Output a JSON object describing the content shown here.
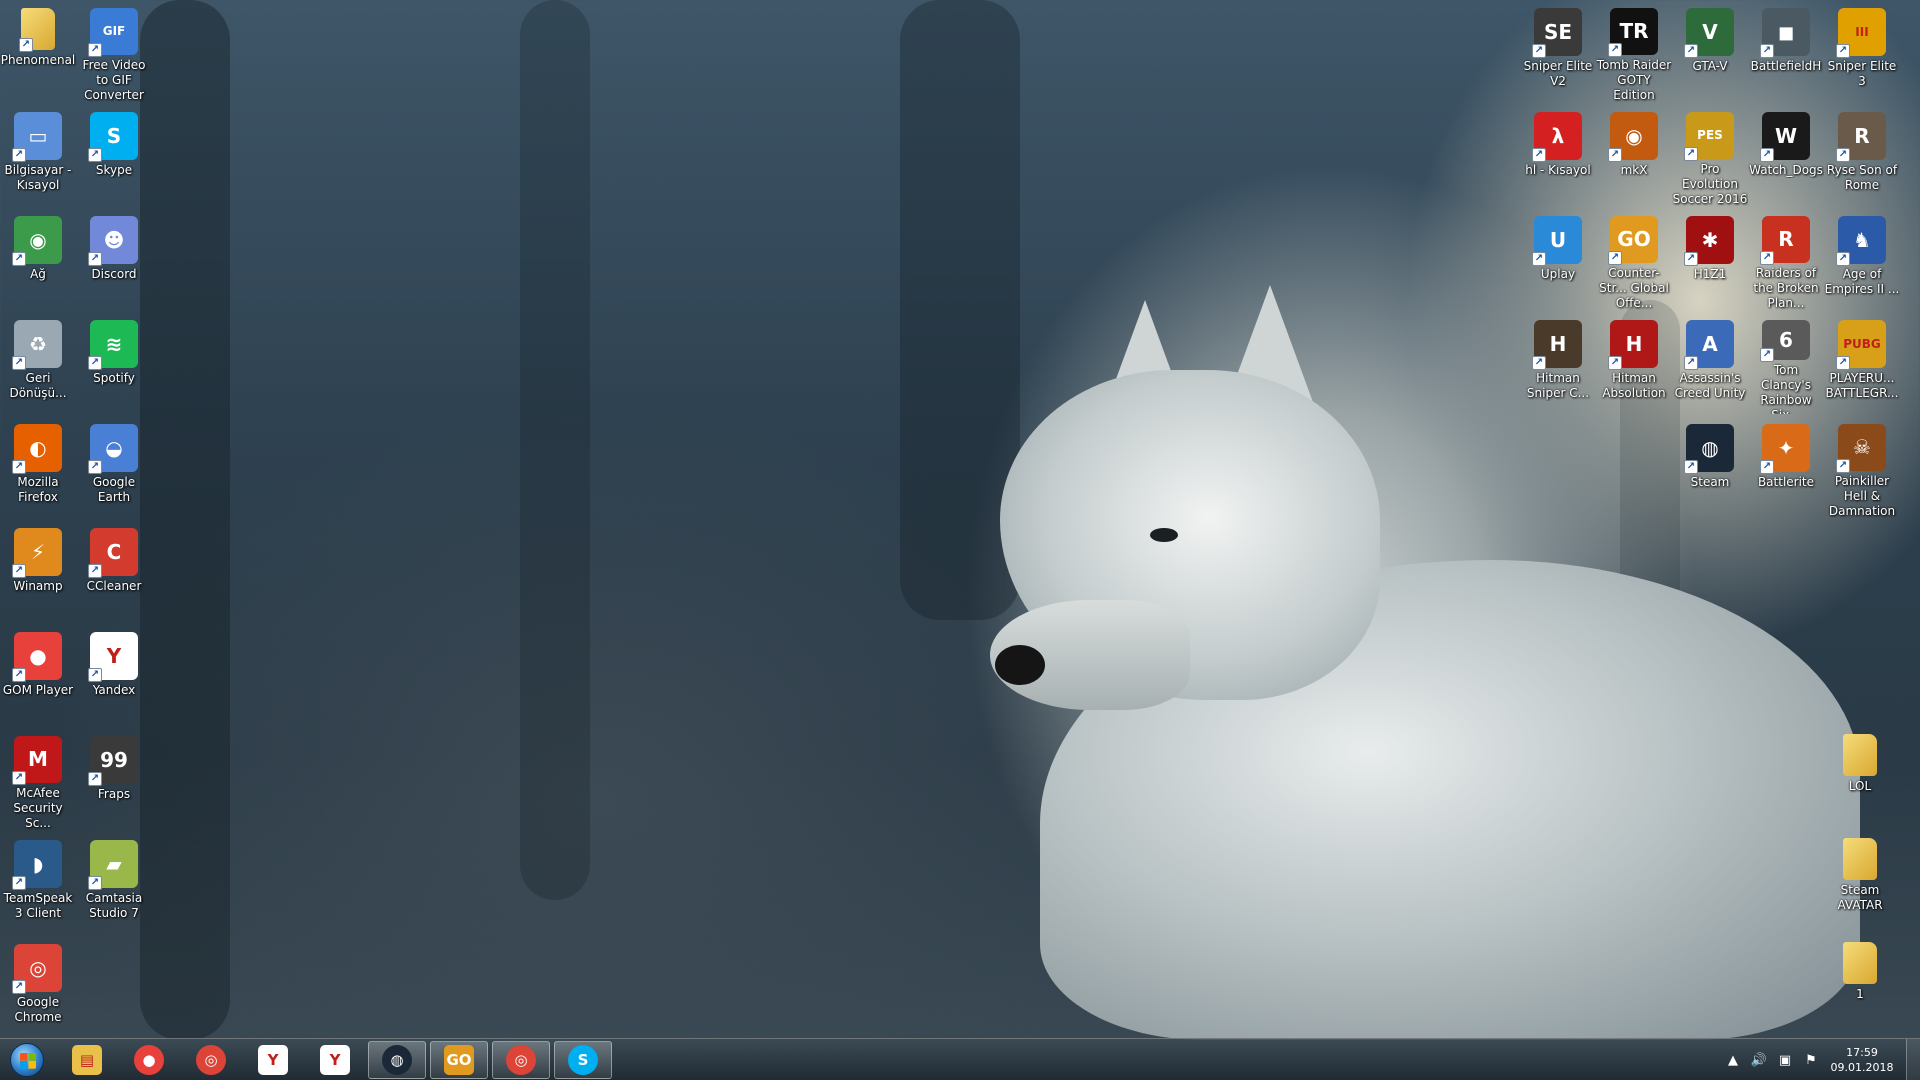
{
  "desktop": {
    "left_icons": [
      {
        "label": "Phenomenal",
        "icon": "folder-icon",
        "color": "#e8c04a",
        "glyph": ""
      },
      {
        "label": "Free Video to GIF Converter",
        "icon": "gif-converter-icon",
        "color": "#3a7bd5",
        "glyph": "GIF"
      },
      {
        "label": "Bilgisayar - Kısayol",
        "icon": "computer-icon",
        "color": "#5a8ed8",
        "glyph": "▭"
      },
      {
        "label": "Skype",
        "icon": "skype-icon",
        "color": "#00aff0",
        "glyph": "S"
      },
      {
        "label": "Ağ",
        "icon": "network-icon",
        "color": "#3b9b4a",
        "glyph": "◉"
      },
      {
        "label": "Discord",
        "icon": "discord-icon",
        "color": "#7289da",
        "glyph": "☻"
      },
      {
        "label": "Geri Dönüşü...",
        "icon": "recycle-bin-icon",
        "color": "#9aa8b4",
        "glyph": "♻"
      },
      {
        "label": "Spotify",
        "icon": "spotify-icon",
        "color": "#1db954",
        "glyph": "≋"
      },
      {
        "label": "Mozilla Firefox",
        "icon": "firefox-icon",
        "color": "#e66000",
        "glyph": "◐"
      },
      {
        "label": "Google Earth",
        "icon": "google-earth-icon",
        "color": "#4a7fd6",
        "glyph": "◒"
      },
      {
        "label": "Winamp",
        "icon": "winamp-icon",
        "color": "#e08a1e",
        "glyph": "⚡"
      },
      {
        "label": "CCleaner",
        "icon": "ccleaner-icon",
        "color": "#d33b2f",
        "glyph": "C"
      },
      {
        "label": "GOM Player",
        "icon": "gom-player-icon",
        "color": "#e8403a",
        "glyph": "●"
      },
      {
        "label": "Yandex",
        "icon": "yandex-icon",
        "color": "#ffffff",
        "glyph": "Y"
      },
      {
        "label": "McAfee Security Sc...",
        "icon": "mcafee-icon",
        "color": "#c01818",
        "glyph": "M"
      },
      {
        "label": "Fraps",
        "icon": "fraps-icon",
        "color": "#3a3a3a",
        "glyph": "99"
      },
      {
        "label": "TeamSpeak 3 Client",
        "icon": "teamspeak-icon",
        "color": "#2a5a8a",
        "glyph": "◗"
      },
      {
        "label": "Camtasia Studio 7",
        "icon": "camtasia-icon",
        "color": "#9ab84a",
        "glyph": "▰"
      },
      {
        "label": "Google Chrome",
        "icon": "chrome-icon",
        "color": "#db4437",
        "glyph": "◎"
      }
    ],
    "right_icons": [
      {
        "label": "Sniper Elite V2",
        "icon": "sniper-elite-v2-icon",
        "color": "#3a3a3a",
        "glyph": "SE"
      },
      {
        "label": "Tomb Raider GOTY Edition",
        "icon": "tomb-raider-icon",
        "color": "#111111",
        "glyph": "TR"
      },
      {
        "label": "GTA-V",
        "icon": "gta-v-icon",
        "color": "#2d6b3a",
        "glyph": "V"
      },
      {
        "label": "BattlefieldH",
        "icon": "battlefield-hardline-icon",
        "color": "#4b5a62",
        "glyph": "◼"
      },
      {
        "label": "Sniper Elite 3",
        "icon": "sniper-elite-3-icon",
        "color": "#e0a000",
        "glyph": "III"
      },
      {
        "label": "hl - Kısayol",
        "icon": "half-life-icon",
        "color": "#d42020",
        "glyph": "λ"
      },
      {
        "label": "mkX",
        "icon": "mortal-kombat-x-icon",
        "color": "#c25a10",
        "glyph": "◉"
      },
      {
        "label": "Pro Evolution Soccer 2016",
        "icon": "pes-2016-icon",
        "color": "#c99a1a",
        "glyph": "PES"
      },
      {
        "label": "Watch_Dogs",
        "icon": "watch-dogs-icon",
        "color": "#1a1a1a",
        "glyph": "W"
      },
      {
        "label": "Ryse Son of Rome",
        "icon": "ryse-icon",
        "color": "#6a5a4a",
        "glyph": "R"
      },
      {
        "label": "Uplay",
        "icon": "uplay-icon",
        "color": "#2a8ad8",
        "glyph": "U"
      },
      {
        "label": "Counter-Str... Global Offe...",
        "icon": "csgo-icon",
        "color": "#e09a20",
        "glyph": "GO"
      },
      {
        "label": "H1Z1",
        "icon": "h1z1-icon",
        "color": "#a01010",
        "glyph": "✱"
      },
      {
        "label": "Raiders of the Broken Plan...",
        "icon": "raiders-icon",
        "color": "#c83020",
        "glyph": "R"
      },
      {
        "label": "Age of Empires II ...",
        "icon": "age-of-empires-icon",
        "color": "#2a5aa8",
        "glyph": "♞"
      },
      {
        "label": "Hitman Sniper C...",
        "icon": "hitman-sniper-icon",
        "color": "#4a3a2a",
        "glyph": "H"
      },
      {
        "label": "Hitman Absolution",
        "icon": "hitman-absolution-icon",
        "color": "#b01818",
        "glyph": "H"
      },
      {
        "label": "Assassin's Creed Unity",
        "icon": "assassins-creed-icon",
        "color": "#3a6ab8",
        "glyph": "A"
      },
      {
        "label": "Tom Clancy's Rainbow Six...",
        "icon": "rainbow-six-icon",
        "color": "#5a5a5a",
        "glyph": "6"
      },
      {
        "label": "PLAYERU... BATTLEGR...",
        "icon": "pubg-icon",
        "color": "#d8a018",
        "glyph": "PUBG"
      },
      {
        "label": "Steam",
        "icon": "steam-icon",
        "color": "#1b2838",
        "glyph": "◍"
      },
      {
        "label": "Battlerite",
        "icon": "battlerite-icon",
        "color": "#d86a18",
        "glyph": "✦"
      },
      {
        "label": "Painkiller Hell & Damnation",
        "icon": "painkiller-icon",
        "color": "#8a4a1a",
        "glyph": "☠"
      }
    ],
    "folder_icons": [
      {
        "label": "LOL",
        "icon": "folder-icon",
        "color": "#e8c04a",
        "glyph": ""
      },
      {
        "label": "Steam AVATAR",
        "icon": "folder-icon",
        "color": "#e8c04a",
        "glyph": ""
      },
      {
        "label": "1",
        "icon": "folder-icon",
        "color": "#e8c04a",
        "glyph": ""
      }
    ]
  },
  "taskbar": {
    "buttons": [
      {
        "name": "explorer",
        "icon": "folder-icon",
        "color": "#e8c04a",
        "glyph": "▤",
        "active": false
      },
      {
        "name": "gom-player",
        "icon": "gom-player-icon",
        "color": "#e8403a",
        "glyph": "●",
        "active": false
      },
      {
        "name": "chrome",
        "icon": "chrome-icon",
        "color": "#db4437",
        "glyph": "◎",
        "active": false
      },
      {
        "name": "yandex-browser",
        "icon": "yandex-icon",
        "color": "#ffffff",
        "glyph": "Y",
        "active": false
      },
      {
        "name": "yandex",
        "icon": "yandex-icon",
        "color": "#ffffff",
        "glyph": "Y",
        "active": false
      },
      {
        "name": "steam",
        "icon": "steam-icon",
        "color": "#1b2838",
        "glyph": "◍",
        "active": true
      },
      {
        "name": "csgo",
        "icon": "csgo-icon",
        "color": "#e09a20",
        "glyph": "GO",
        "active": true
      },
      {
        "name": "chrome-window",
        "icon": "chrome-icon",
        "color": "#db4437",
        "glyph": "◎",
        "active": true
      },
      {
        "name": "skype",
        "icon": "skype-icon",
        "color": "#00aff0",
        "glyph": "S",
        "active": true
      }
    ],
    "tray": {
      "time": "17:59",
      "date": "09.01.2018"
    }
  }
}
